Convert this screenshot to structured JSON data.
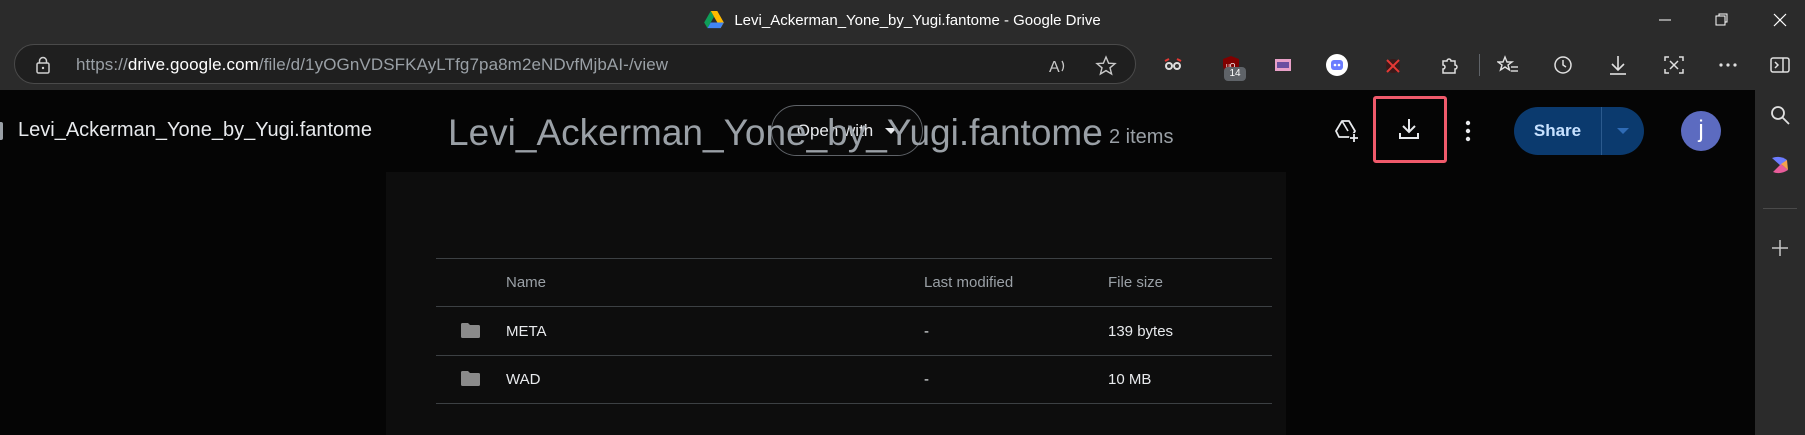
{
  "window": {
    "title": "Levi_Ackerman_Yone_by_Yugi.fantome - Google Drive"
  },
  "addressbar": {
    "url_prefix": "https://",
    "url_host": "drive.google.com",
    "url_path": "/file/d/1yOGnVDSFKAyLTfg7pa8m2eNDvfMjbAI-/view"
  },
  "extensions": {
    "ublock_badge": "14"
  },
  "viewer": {
    "file_title": "Levi_Ackerman_Yone_by_Yugi.fantome",
    "open_with_label": "Open with",
    "share_label": "Share",
    "avatar_initial": "j"
  },
  "folder": {
    "title": "Levi_Ackerman_Yone_by_Yugi.fantome",
    "count": "2 items",
    "columns": [
      "Name",
      "Last modified",
      "File size"
    ],
    "rows": [
      {
        "name": "META",
        "modified": "-",
        "size": "139 bytes"
      },
      {
        "name": "WAD",
        "modified": "-",
        "size": "10 MB"
      }
    ]
  },
  "colors": {
    "highlight": "#f05a6b",
    "share_bg": "#0b3a6e",
    "avatar_bg": "#5c6bc0"
  }
}
